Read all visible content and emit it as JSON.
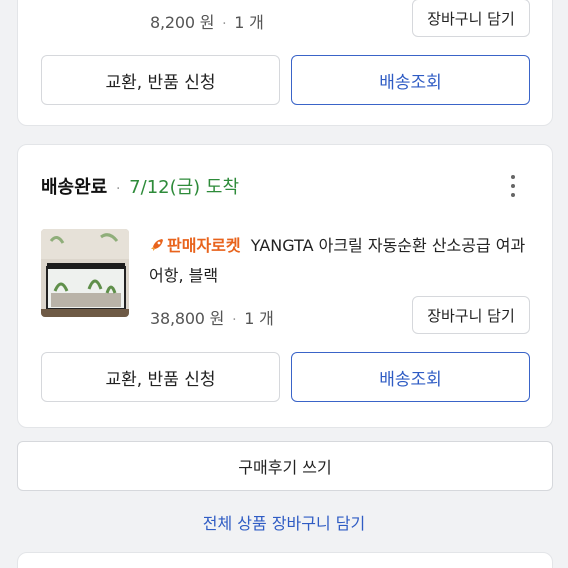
{
  "order_top": {
    "price": "8,200 원",
    "separator": "·",
    "quantity": "1 개",
    "add_to_cart_label": "장바구니 담기",
    "exchange_return_label": "교환, 반품 신청",
    "track_shipping_label": "배송조회"
  },
  "order_main": {
    "status_label": "배송완료",
    "status_separator": "·",
    "status_date": "7/12(금) 도착",
    "rocket_badge": "판매자로켓",
    "product_name": "YANGTA 아크릴 자동순환 산소공급 여과 어항, 블랙",
    "price": "38,800 원",
    "separator": "·",
    "quantity": "1 개",
    "add_to_cart_label": "장바구니 담기",
    "exchange_return_label": "교환, 반품 신청",
    "track_shipping_label": "배송조회"
  },
  "footer": {
    "write_review_label": "구매후기 쓰기",
    "add_all_to_cart_label": "전체 상품 장바구니 담기"
  },
  "colors": {
    "status_green": "#2e8b3a",
    "rocket_orange": "#e8631c",
    "link_blue": "#2f5cc4",
    "button_blue_border": "#3a64c8"
  }
}
